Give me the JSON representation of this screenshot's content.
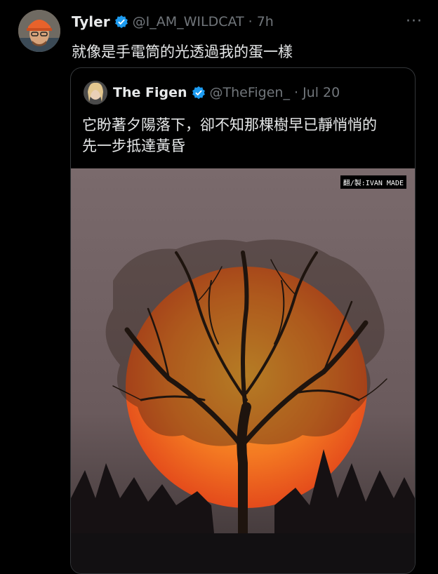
{
  "tweet": {
    "author_name": "Tyler",
    "author_handle": "@I_AM_WILDCAT",
    "time": "7h",
    "text": "就像是手電筒的光透過我的蛋一樣",
    "more_icon": "more-dots-icon",
    "verified_icon": "verified-badge-icon"
  },
  "quoted_tweet": {
    "author_name": "The Figen",
    "author_handle": "@TheFigen_",
    "date": "Jul 20",
    "line1": "它盼著夕陽落下，卻不知那棵樹早已靜悄悄的",
    "line2": "先一步抵達黃昏",
    "image_watermark": "翻/製:IVAN MADE"
  },
  "colors": {
    "background": "#000000",
    "text": "#e7e9ea",
    "secondary": "#71767b",
    "verified": "#1d9bf0",
    "sun": "#f05a1e",
    "sky": "#7a6a6c"
  }
}
